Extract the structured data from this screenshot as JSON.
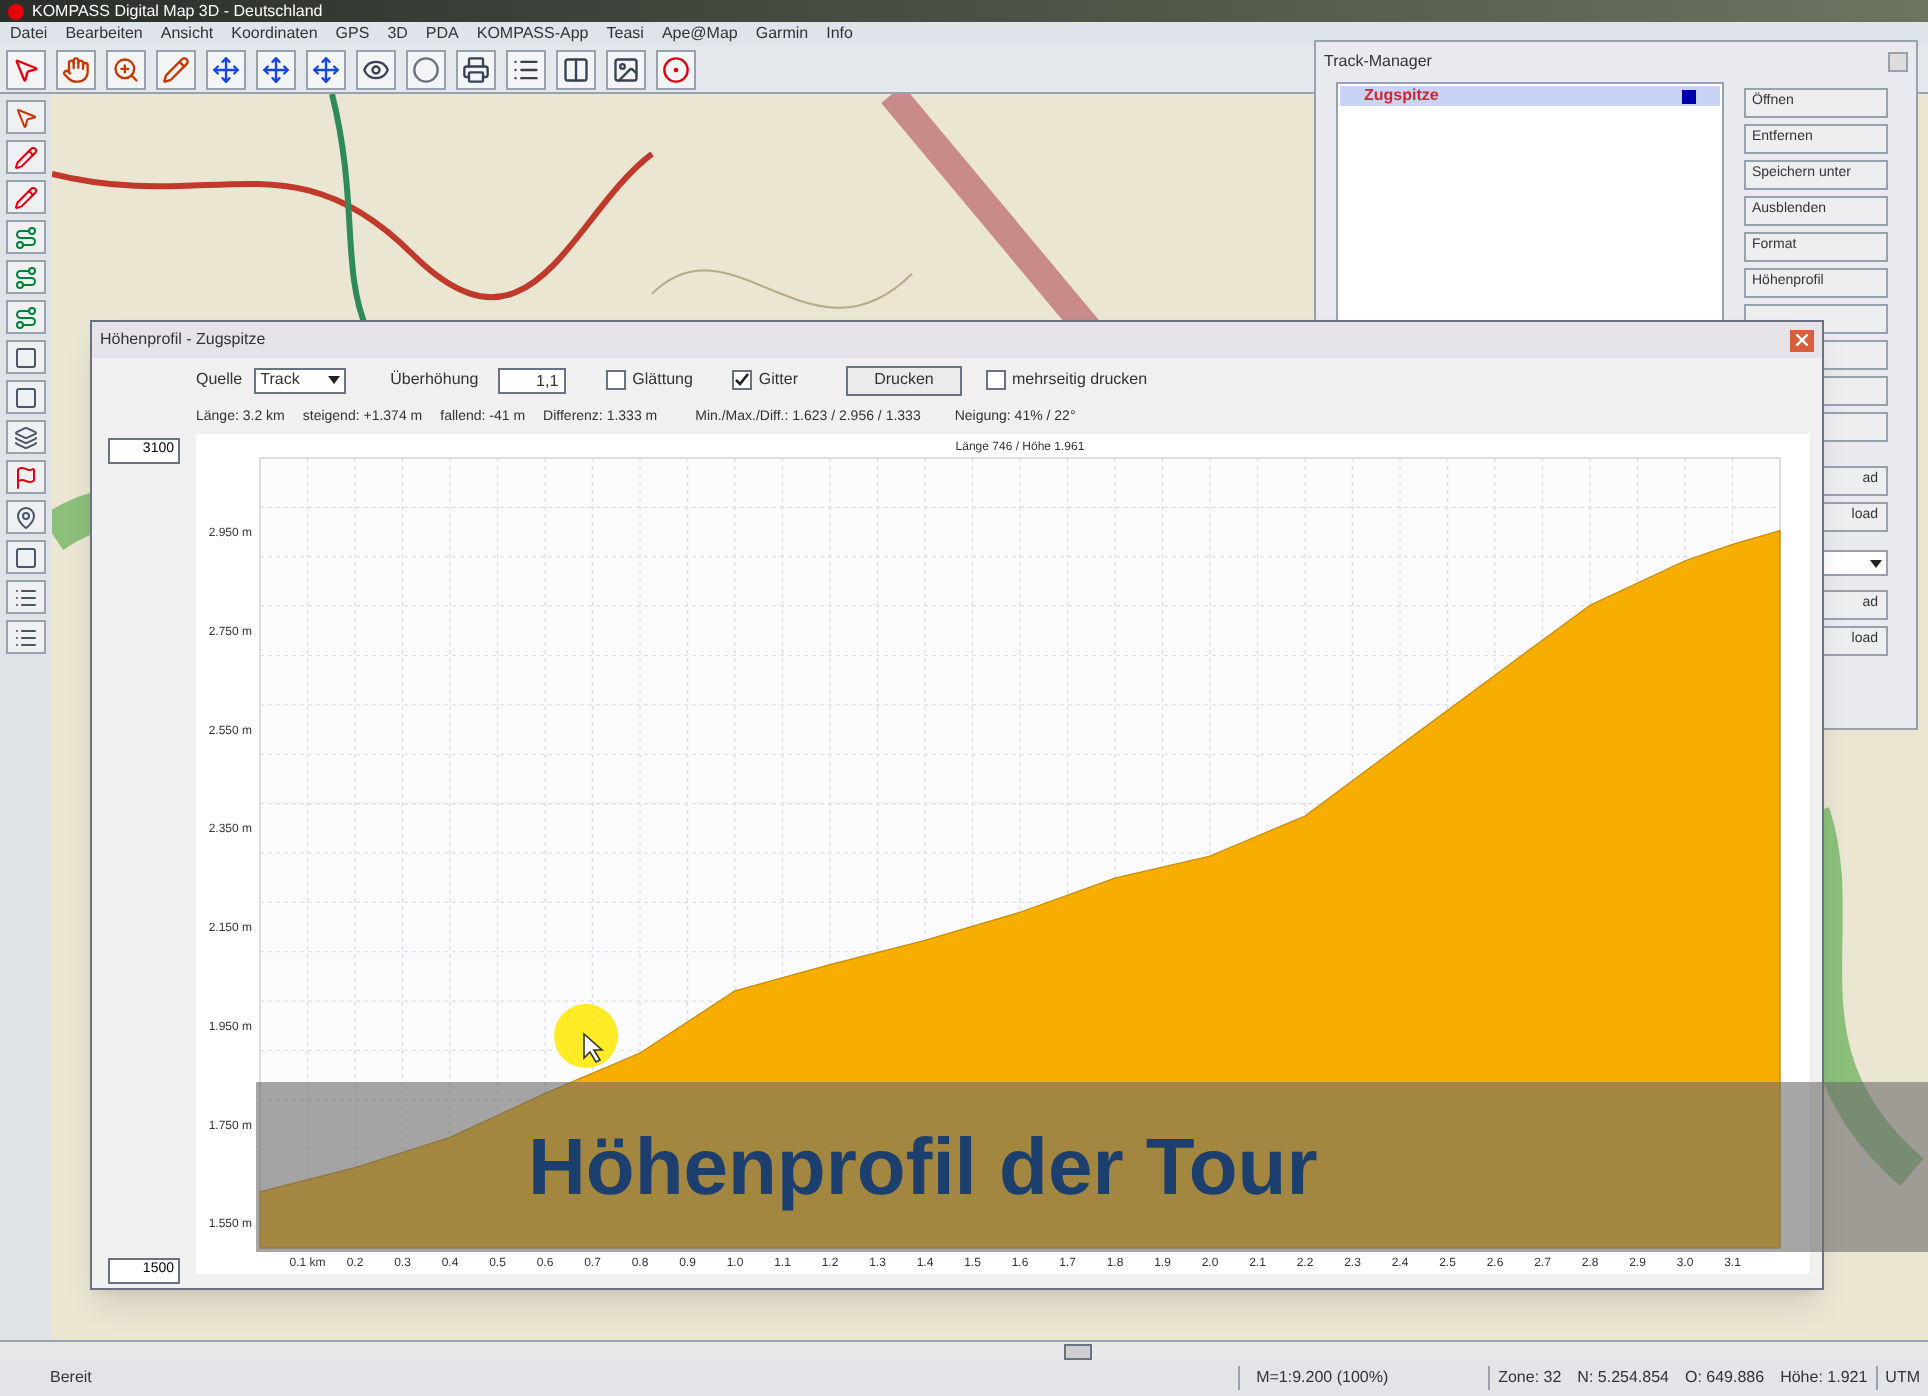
{
  "app": {
    "title": "KOMPASS Digital Map 3D - Deutschland"
  },
  "menu": [
    "Datei",
    "Bearbeiten",
    "Ansicht",
    "Koordinaten",
    "GPS",
    "3D",
    "PDA",
    "KOMPASS-App",
    "Teasi",
    "Ape@Map",
    "Garmin",
    "Info"
  ],
  "track_manager": {
    "title": "Track-Manager",
    "tracks": [
      {
        "name": "Zugspitze",
        "selected": true,
        "color": "#0000a8"
      }
    ],
    "buttons": [
      "Öffnen",
      "Entfernen",
      "Speichern unter",
      "Ausblenden",
      "Format",
      "Höhenprofil"
    ],
    "covered_controls": [
      {
        "kind": "button",
        "label": "ad"
      },
      {
        "kind": "button",
        "label": "load"
      },
      {
        "kind": "dropdown"
      },
      {
        "kind": "button",
        "label": "ad"
      },
      {
        "kind": "button",
        "label": "load"
      }
    ]
  },
  "profile": {
    "title": "Höhenprofil - Zugspitze",
    "source_label": "Quelle",
    "source_value": "Track",
    "exaggeration_label": "Überhöhung",
    "exaggeration_value": "1,1",
    "options": [
      {
        "label": "Glättung",
        "checked": false
      },
      {
        "label": "Gitter",
        "checked": true
      }
    ],
    "print_button": "Drucken",
    "multipage": {
      "label": "mehrseitig drucken",
      "checked": false
    },
    "stats": [
      "Länge: 3.2 km",
      "steigend: +1.374 m",
      "fallend: -41 m",
      "Differenz: 1.333 m",
      "Min./Max./Diff.: 1.623 / 2.956 / 1.333",
      "Neigung: 41% / 22°"
    ],
    "y_max_value": "3100",
    "y_min_value": "1500",
    "chart_data": {
      "type": "area",
      "title": "Länge 746 / Höhe 1.961",
      "x": [
        0,
        0.2,
        0.4,
        0.6,
        0.8,
        1.0,
        1.2,
        1.4,
        1.6,
        1.8,
        2.0,
        2.2,
        2.4,
        2.6,
        2.8,
        3.0,
        3.1,
        3.2
      ],
      "series": [
        {
          "color": "#f7ae00",
          "values": [
            1.614,
            1.663,
            1.724,
            1.813,
            1.895,
            2.021,
            2.074,
            2.123,
            2.18,
            2.249,
            2.294,
            2.375,
            2.518,
            2.66,
            2.802,
            2.892,
            2.925,
            2.953
          ]
        }
      ],
      "xlim": [
        0,
        3.2
      ],
      "ylim": [
        1.5,
        3.1
      ],
      "grid": true,
      "xticks": [
        {
          "value": 0.1,
          "label": "0.1 km"
        },
        0.2,
        0.3,
        0.4,
        0.5,
        0.6,
        0.7,
        0.8,
        0.9,
        {
          "value": 1,
          "label": "1.0"
        },
        1.1,
        1.2,
        1.3,
        1.4,
        1.5,
        1.6,
        1.7,
        1.8,
        1.9,
        {
          "value": 2,
          "label": "2.0"
        },
        2.1,
        2.2,
        2.3,
        2.4,
        2.5,
        2.6,
        2.7,
        2.8,
        2.9,
        {
          "value": 3,
          "label": "3.0"
        },
        3.1
      ],
      "yticks": [
        {
          "value": 1.55,
          "label": "1.550 m"
        },
        {
          "value": 1.75,
          "label": "1.750 m"
        },
        {
          "value": 1.95,
          "label": "1.950 m"
        },
        {
          "value": 2.15,
          "label": "2.150 m"
        },
        {
          "value": 2.35,
          "label": "2.350 m"
        },
        {
          "value": 2.55,
          "label": "2.550 m"
        },
        {
          "value": 2.75,
          "label": "2.750 m"
        },
        {
          "value": 2.95,
          "label": "2.950 m"
        }
      ]
    }
  },
  "caption": "Höhenprofil der Tour",
  "status_bar": [
    "Bereit",
    "M=1:9.200 (100%)",
    "Zone: 32",
    "N: 5.254.854",
    "O: 649.886",
    "Höhe: 1.921",
    "UTM"
  ]
}
